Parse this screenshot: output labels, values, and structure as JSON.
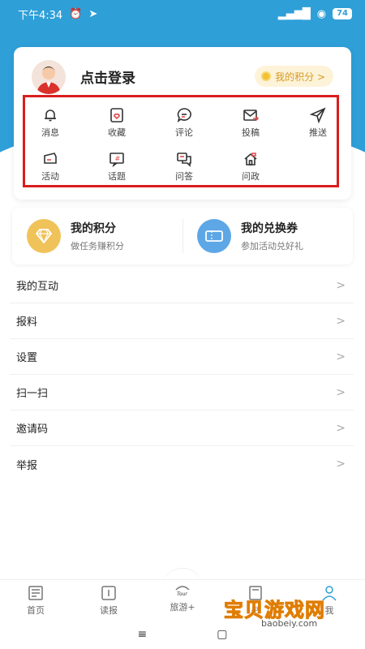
{
  "status": {
    "time": "下午4:34",
    "battery": "74"
  },
  "account": {
    "login_label": "点击登录",
    "points_button": "我的积分 >"
  },
  "quick_grid": [
    {
      "label": "消息",
      "icon": "bell-icon"
    },
    {
      "label": "收藏",
      "icon": "favorite-icon"
    },
    {
      "label": "评论",
      "icon": "comment-icon"
    },
    {
      "label": "投稿",
      "icon": "submit-mail-icon"
    },
    {
      "label": "推送",
      "icon": "send-icon"
    },
    {
      "label": "活动",
      "icon": "ticket-icon"
    },
    {
      "label": "话题",
      "icon": "topic-icon"
    },
    {
      "label": "问答",
      "icon": "qa-icon"
    },
    {
      "label": "问政",
      "icon": "government-icon"
    }
  ],
  "promo": {
    "points": {
      "title": "我的积分",
      "subtitle": "做任务赚积分",
      "icon": "diamond-icon",
      "color": "#f0c35a"
    },
    "coupons": {
      "title": "我的兑换券",
      "subtitle": "参加活动兑好礼",
      "icon": "coupon-icon",
      "color": "#5ea7e6"
    }
  },
  "menu": [
    {
      "label": "我的互动"
    },
    {
      "label": "报料"
    },
    {
      "label": "设置"
    },
    {
      "label": "扫一扫"
    },
    {
      "label": "邀请码"
    },
    {
      "label": "举报"
    }
  ],
  "tabs": [
    {
      "label": "首页",
      "icon": "newspaper-icon"
    },
    {
      "label": "读报",
      "icon": "reader-icon"
    },
    {
      "label": "旅游+",
      "icon": "travel-logo-icon"
    },
    {
      "label": "书",
      "icon": "book-icon"
    },
    {
      "label": "我",
      "icon": "user-icon"
    }
  ],
  "watermark": {
    "title": "宝贝游戏网",
    "url": "baobeiy.com"
  },
  "colors": {
    "header_blue": "#2f9fd8",
    "highlight_red": "#d81e1e",
    "points_gold": "#d89a22"
  }
}
